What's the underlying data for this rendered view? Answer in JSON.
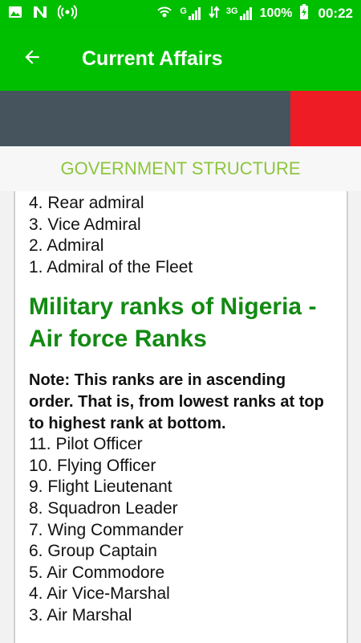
{
  "status_bar": {
    "network_labels": [
      "G",
      "3G"
    ],
    "battery": "100%",
    "time": "00:22"
  },
  "app_bar": {
    "title": "Current Affairs"
  },
  "section": {
    "title": "GOVERNMENT STRUCTURE"
  },
  "content": {
    "navy_ranks_tail": [
      "4. Rear admiral",
      "3. Vice Admiral",
      "2. Admiral",
      "1. Admiral of the Fleet"
    ],
    "heading": "Military ranks of Nigeria - Air force Ranks",
    "note": "Note: This ranks are in ascending order. That is, from lowest ranks at top to highest rank at bottom.",
    "air_force_ranks": [
      "11. Pilot Officer",
      "10. Flying Officer",
      "9. Flight Lieutenant",
      "8. Squadron Leader",
      "7. Wing Commander",
      "6. Group Captain",
      "5. Air Commodore",
      "4. Air Vice-Marshal",
      "3. Air Marshal"
    ]
  },
  "colors": {
    "app_bar": "#00bf00",
    "banner": "#46545e",
    "banner_accent": "#ee1c24",
    "section_title": "#8cc63e",
    "heading": "#128a12"
  }
}
